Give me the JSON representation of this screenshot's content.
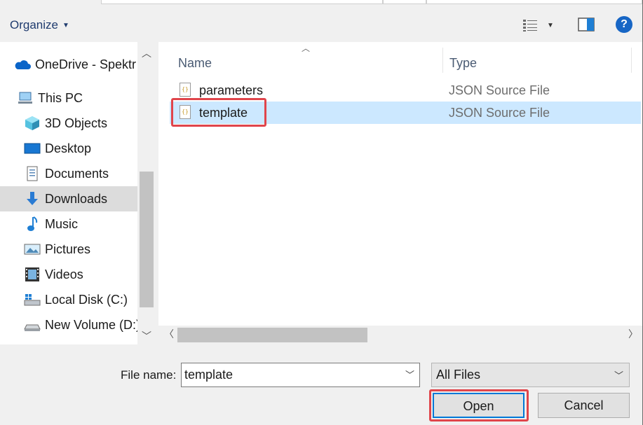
{
  "toolbar": {
    "organize_label": "Organize",
    "help_label": "?"
  },
  "nav": {
    "items": [
      {
        "label": "OneDrive - Spektr",
        "icon": "onedrive-cloud-icon"
      },
      {
        "label": "This PC",
        "icon": "computer-icon"
      },
      {
        "label": "3D Objects",
        "icon": "3d-objects-icon"
      },
      {
        "label": "Desktop",
        "icon": "desktop-icon"
      },
      {
        "label": "Documents",
        "icon": "documents-icon"
      },
      {
        "label": "Downloads",
        "icon": "download-arrow-icon",
        "selected": true
      },
      {
        "label": "Music",
        "icon": "music-note-icon"
      },
      {
        "label": "Pictures",
        "icon": "pictures-icon"
      },
      {
        "label": "Videos",
        "icon": "film-strip-icon"
      },
      {
        "label": "Local Disk (C:)",
        "icon": "windows-drive-icon"
      },
      {
        "label": "New Volume (D:)",
        "icon": "drive-icon"
      }
    ]
  },
  "files": {
    "columns": {
      "name": "Name",
      "type": "Type"
    },
    "rows": [
      {
        "name": "parameters",
        "type": "JSON Source File",
        "icon": "json-file-icon"
      },
      {
        "name": "template",
        "type": "JSON Source File",
        "icon": "json-file-icon",
        "selected": true
      }
    ]
  },
  "footer": {
    "file_name_label": "File name:",
    "file_name_value": "template",
    "filter_value": "All Files",
    "open_label": "Open",
    "cancel_label": "Cancel"
  },
  "colors": {
    "accent": "#0078d7",
    "selection": "#cce8ff",
    "annotation_red": "#e0454b",
    "help_blue": "#1766c5"
  }
}
